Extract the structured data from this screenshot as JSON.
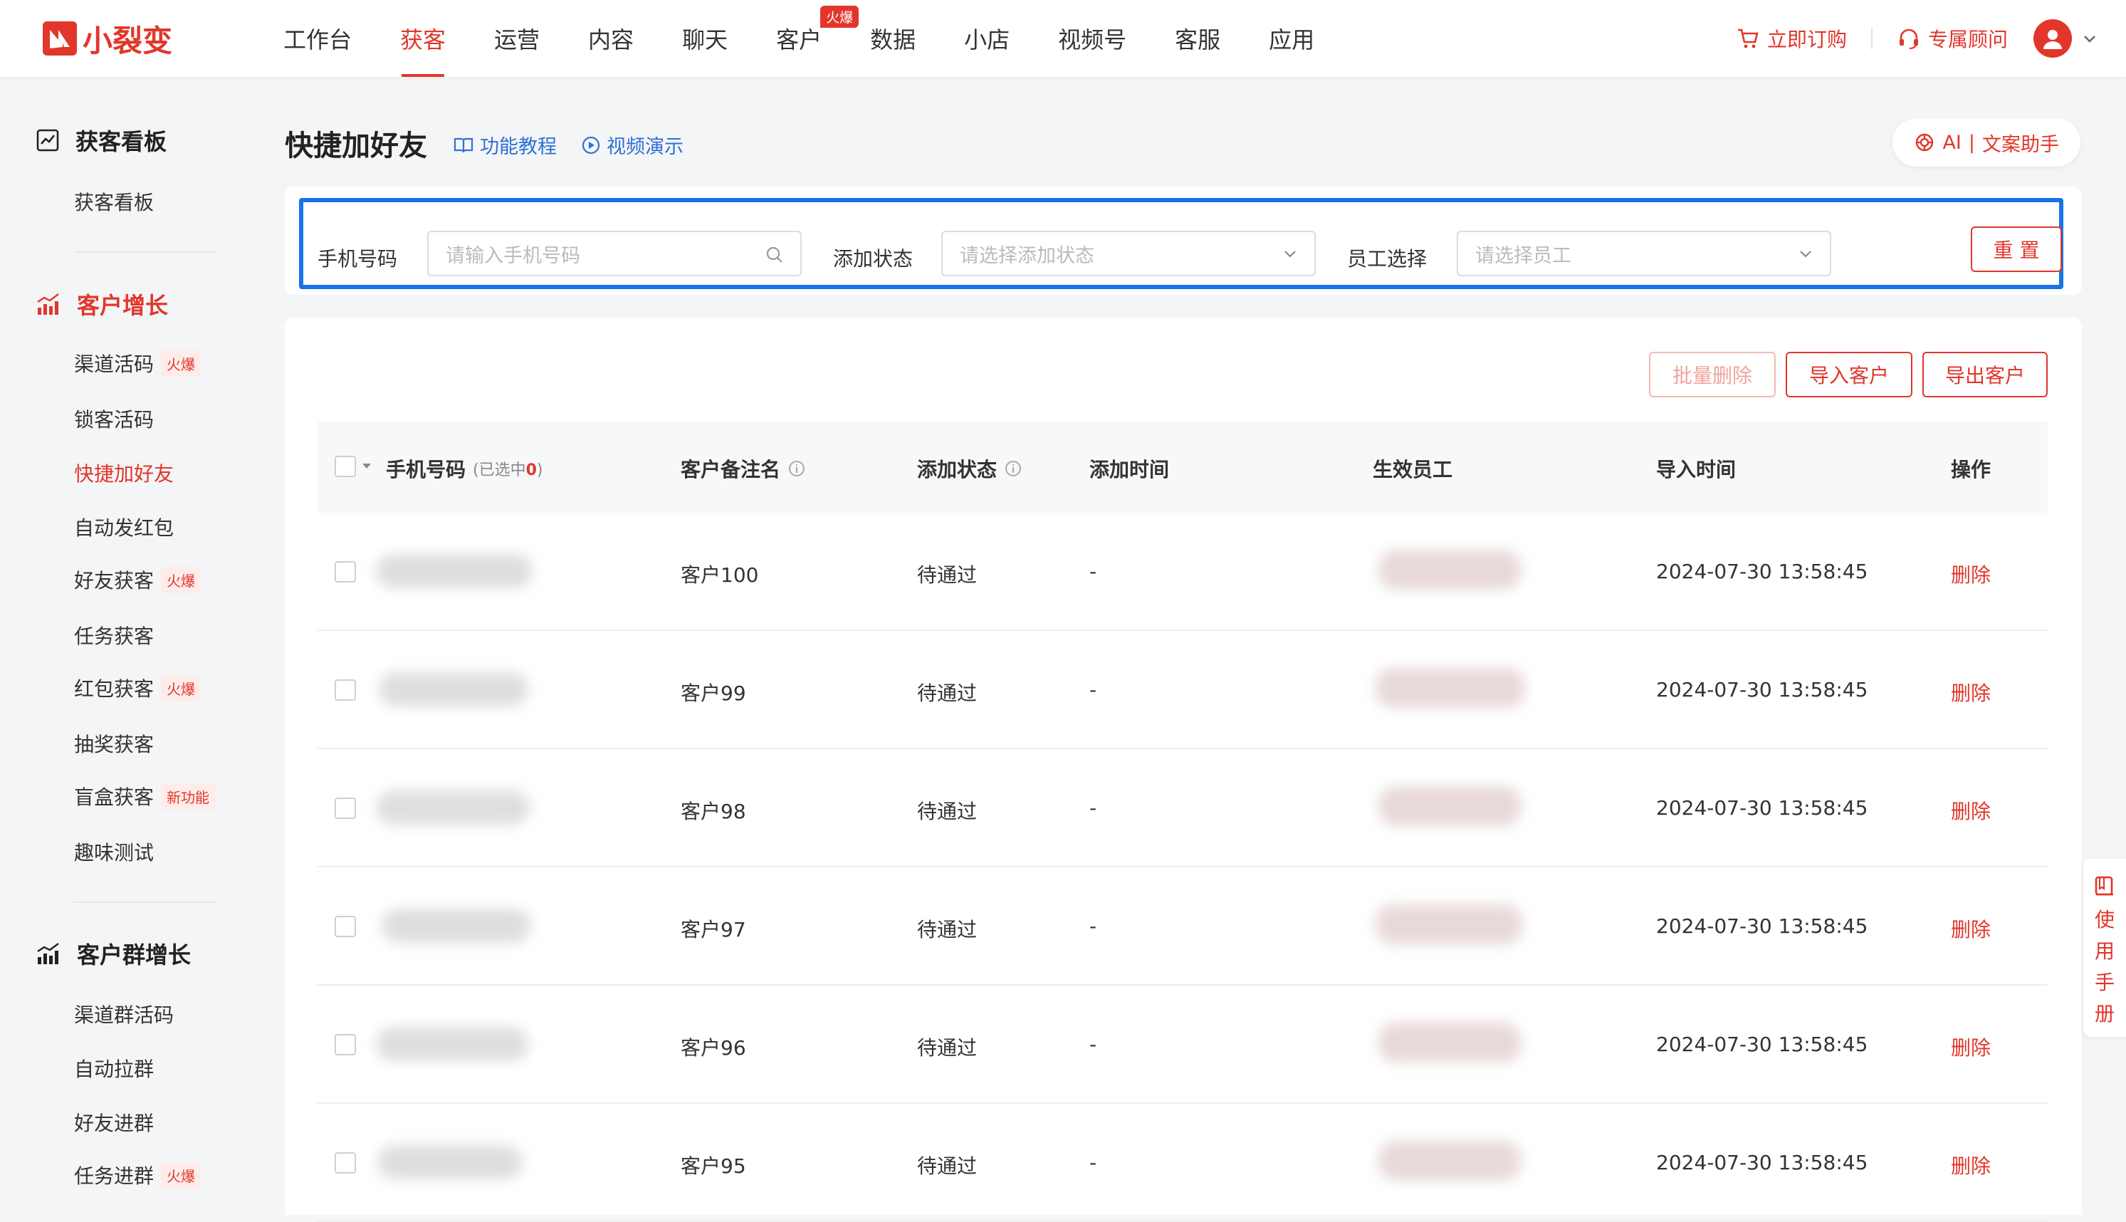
{
  "brand": {
    "name": "小裂变",
    "accent": "#e2362b",
    "highlight": "#1a73e8"
  },
  "nav": {
    "items": [
      {
        "label": "工作台",
        "active": false
      },
      {
        "label": "获客",
        "active": true
      },
      {
        "label": "运营",
        "active": false
      },
      {
        "label": "内容",
        "active": false
      },
      {
        "label": "聊天",
        "active": false
      },
      {
        "label": "客户",
        "active": false,
        "badge": "火爆"
      },
      {
        "label": "数据",
        "active": false
      },
      {
        "label": "小店",
        "active": false
      },
      {
        "label": "视频号",
        "active": false
      },
      {
        "label": "客服",
        "active": false
      },
      {
        "label": "应用",
        "active": false
      }
    ],
    "order_label": "立即订购",
    "advisor_label": "专属顾问"
  },
  "sidebar": {
    "group1": {
      "title": "获客看板",
      "items": [
        {
          "label": "获客看板"
        }
      ]
    },
    "group2": {
      "title": "客户增长",
      "items": [
        {
          "label": "渠道活码",
          "tag": "火爆"
        },
        {
          "label": "锁客活码"
        },
        {
          "label": "快捷加好友",
          "active": true
        },
        {
          "label": "自动发红包"
        },
        {
          "label": "好友获客",
          "tag": "火爆"
        },
        {
          "label": "任务获客"
        },
        {
          "label": "红包获客",
          "tag": "火爆"
        },
        {
          "label": "抽奖获客"
        },
        {
          "label": "盲盒获客",
          "tag": "新功能"
        },
        {
          "label": "趣味测试"
        }
      ]
    },
    "group3": {
      "title": "客户群增长",
      "items": [
        {
          "label": "渠道群活码"
        },
        {
          "label": "自动拉群"
        },
        {
          "label": "好友进群"
        },
        {
          "label": "任务进群",
          "tag": "火爆"
        }
      ]
    }
  },
  "page": {
    "title": "快捷加好友",
    "tutorial_link": "功能教程",
    "video_link": "视频演示",
    "ai_label": "AI",
    "ai_assistant": "文案助手",
    "ai_separator": "|"
  },
  "filters": {
    "phone_label": "手机号码",
    "phone_placeholder": "请输入手机号码",
    "status_label": "添加状态",
    "status_placeholder": "请选择添加状态",
    "staff_label": "员工选择",
    "staff_placeholder": "请选择员工",
    "reset_label": "重 置"
  },
  "actions": {
    "batch_delete": "批量删除",
    "import": "导入客户",
    "export": "导出客户"
  },
  "table": {
    "headers": {
      "phone": "手机号码",
      "selected_prefix": "(已选中",
      "selected_count": "0",
      "selected_suffix": ")",
      "remark": "客户备注名",
      "status": "添加状态",
      "add_time": "添加时间",
      "staff": "生效员工",
      "import_time": "导入时间",
      "op": "操作"
    },
    "rows": [
      {
        "remark": "客户100",
        "status": "待通过",
        "add_time": "-",
        "import_time": "2024-07-30 13:58:45",
        "op": "删除"
      },
      {
        "remark": "客户99",
        "status": "待通过",
        "add_time": "-",
        "import_time": "2024-07-30 13:58:45",
        "op": "删除"
      },
      {
        "remark": "客户98",
        "status": "待通过",
        "add_time": "-",
        "import_time": "2024-07-30 13:58:45",
        "op": "删除"
      },
      {
        "remark": "客户97",
        "status": "待通过",
        "add_time": "-",
        "import_time": "2024-07-30 13:58:45",
        "op": "删除"
      },
      {
        "remark": "客户96",
        "status": "待通过",
        "add_time": "-",
        "import_time": "2024-07-30 13:58:45",
        "op": "删除"
      },
      {
        "remark": "客户95",
        "status": "待通过",
        "add_time": "-",
        "import_time": "2024-07-30 13:58:45",
        "op": "删除"
      }
    ]
  },
  "manual": {
    "label": "使用手册"
  }
}
